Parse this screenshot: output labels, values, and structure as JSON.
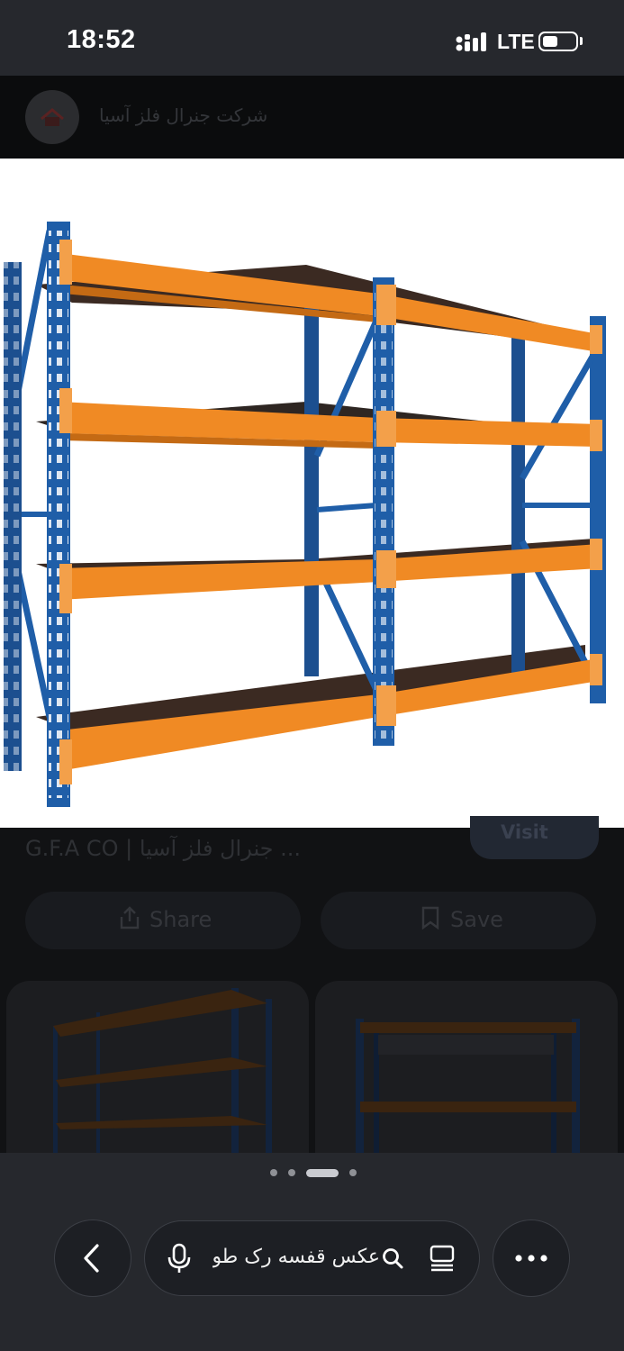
{
  "status_bar": {
    "time": "18:52",
    "network": "LTE",
    "battery_level": 0.45
  },
  "header": {
    "site_name": "شرکت جنرال فلز آسیا",
    "logo_icon": "site-logo-icon"
  },
  "result": {
    "caption": "G.F.A CO | جنرال فلز آسیا ...",
    "visit_label": "Visit",
    "share_label": "Share",
    "save_label": "Save"
  },
  "carousel": {
    "pages": 4,
    "active_page": 3
  },
  "bottom_nav": {
    "search_query": "عکس قفسه رک طو",
    "icons": [
      "back-icon",
      "mic-icon",
      "search-icon",
      "lens-icon",
      "more-icon"
    ]
  },
  "colors": {
    "upright_blue": "#1f5ea8",
    "beam_orange": "#f08a24",
    "deck_brown": "#3b2a22",
    "status_bar": "#26282d"
  }
}
